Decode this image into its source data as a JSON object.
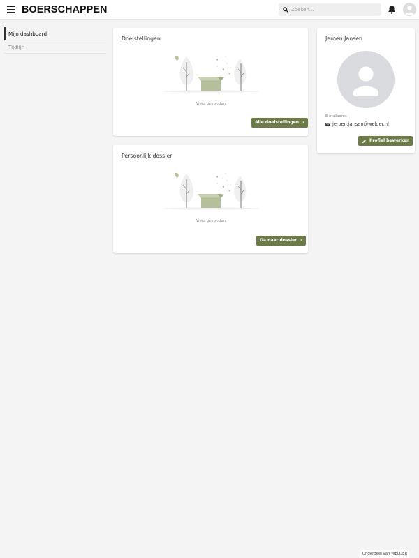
{
  "header": {
    "logo": "BOERSCHAPPEN",
    "search_placeholder": "Zoeken...",
    "icons": [
      "menu-icon",
      "search-icon",
      "bell-icon",
      "user-avatar"
    ]
  },
  "sidebar": {
    "items": [
      {
        "label": "Mijn dashboard",
        "active": true
      },
      {
        "label": "Tijdlijn",
        "active": false
      }
    ]
  },
  "goals": {
    "title": "Doelstellingen",
    "empty_text": "Niets gevonden",
    "button_label": "Alle doelstellingen"
  },
  "dossier": {
    "title": "Persoonlijk dossier",
    "empty_text": "Niets gevonden",
    "button_label": "Ga naar dossier"
  },
  "profile": {
    "name": "Jeroen Jansen",
    "email_label": "E-mailadres",
    "email": "jeroen.jansen@welder.nl",
    "edit_label": "Profiel bewerken"
  },
  "footer": {
    "text": "Onderdeel van WELDER"
  },
  "colors": {
    "accent": "#6c7a47",
    "background": "#f4f4f4",
    "illustration": "#b6bf9c"
  }
}
